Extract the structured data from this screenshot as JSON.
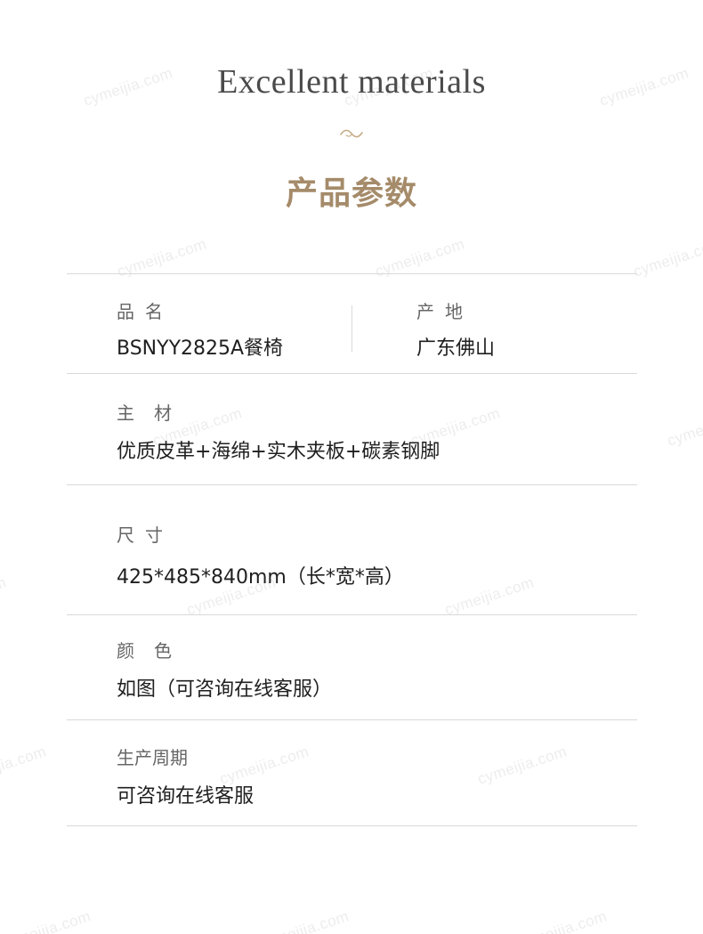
{
  "watermark": "cymeijia.com",
  "heading": {
    "english": "Excellent materials",
    "chinese": "产品参数"
  },
  "colors": {
    "accent": "#a58b6a",
    "divider": "#d9d9d9",
    "label": "#666666",
    "value": "#1f1f1f"
  },
  "specs": {
    "name": {
      "label": "品名",
      "value": "BSNYY2825A餐椅"
    },
    "origin": {
      "label": "产地",
      "value": "广东佛山"
    },
    "material": {
      "label": "主材",
      "value": "优质皮革+海绵+实木夹板+碳素钢脚"
    },
    "size": {
      "label": "尺寸",
      "value": "425*485*840mm（长*宽*高）"
    },
    "color": {
      "label": "颜色",
      "value": "如图（可咨询在线客服）"
    },
    "cycle": {
      "label": "生产周期",
      "value": "可咨询在线客服"
    }
  }
}
